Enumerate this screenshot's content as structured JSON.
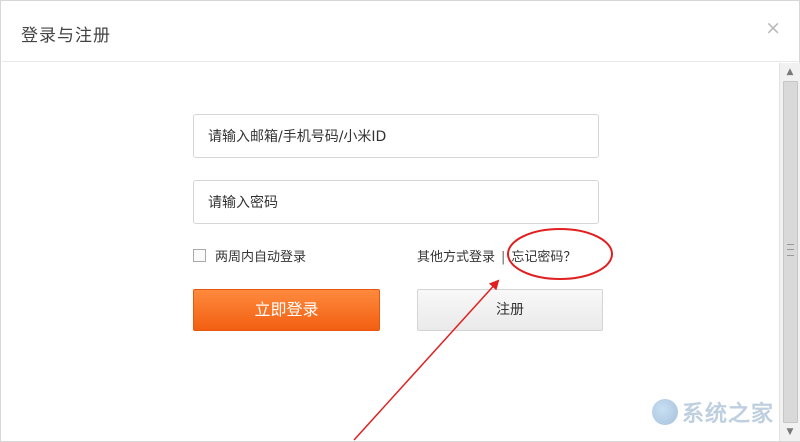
{
  "dialog": {
    "title": "登录与注册",
    "close_label": "×"
  },
  "form": {
    "account_placeholder": "请输入邮箱/手机号码/小米ID",
    "password_placeholder": "请输入密码",
    "remember_label": "两周内自动登录",
    "remember_checked": false,
    "other_login_label": "其他方式登录",
    "separator": "|",
    "forgot_label": "忘记密码？",
    "login_button": "立即登录",
    "register_button": "注册"
  },
  "scrollbar": {
    "up_icon": "▲",
    "down_icon": "▼"
  },
  "annotation": {
    "highlight_target": "忘记密码？",
    "color": "#e02020"
  },
  "watermark": {
    "text": "系统之家"
  },
  "colors": {
    "login_accent": "#f36a1e",
    "annotation_red": "#e02020"
  }
}
